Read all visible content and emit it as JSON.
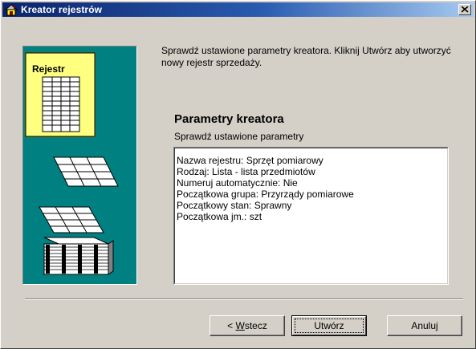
{
  "window": {
    "title": "Kreator rejestrów"
  },
  "illustration": {
    "label": "Rejestr"
  },
  "intro_text": "Sprawdź ustawione parametry kreatora. Kliknij Utwórz aby utworzyć nowy rejestr sprzedaży.",
  "parameters": {
    "heading": "Parametry kreatora",
    "subheading": "Sprawdź ustawione parametry",
    "items": [
      "Nazwa rejestru: Sprzęt pomiarowy",
      "Rodzaj: Lista - lista przedmiotów",
      "Numeruj automatycznie: Nie",
      "Początkowa grupa: Przyrządy pomiarowe",
      "Początkowy stan: Sprawny",
      "Początkowa jm.: szt"
    ]
  },
  "buttons": {
    "back_prefix": "< ",
    "back_mnemonic": "W",
    "back_rest": "stecz",
    "create": "Utwórz",
    "cancel": "Anuluj"
  },
  "icons": {
    "title_icon": "house-icon",
    "close_icon": "close-icon"
  },
  "colors": {
    "title_active": "#0a246a",
    "illustration_bg": "#008080",
    "register_card": "#ffff80"
  }
}
